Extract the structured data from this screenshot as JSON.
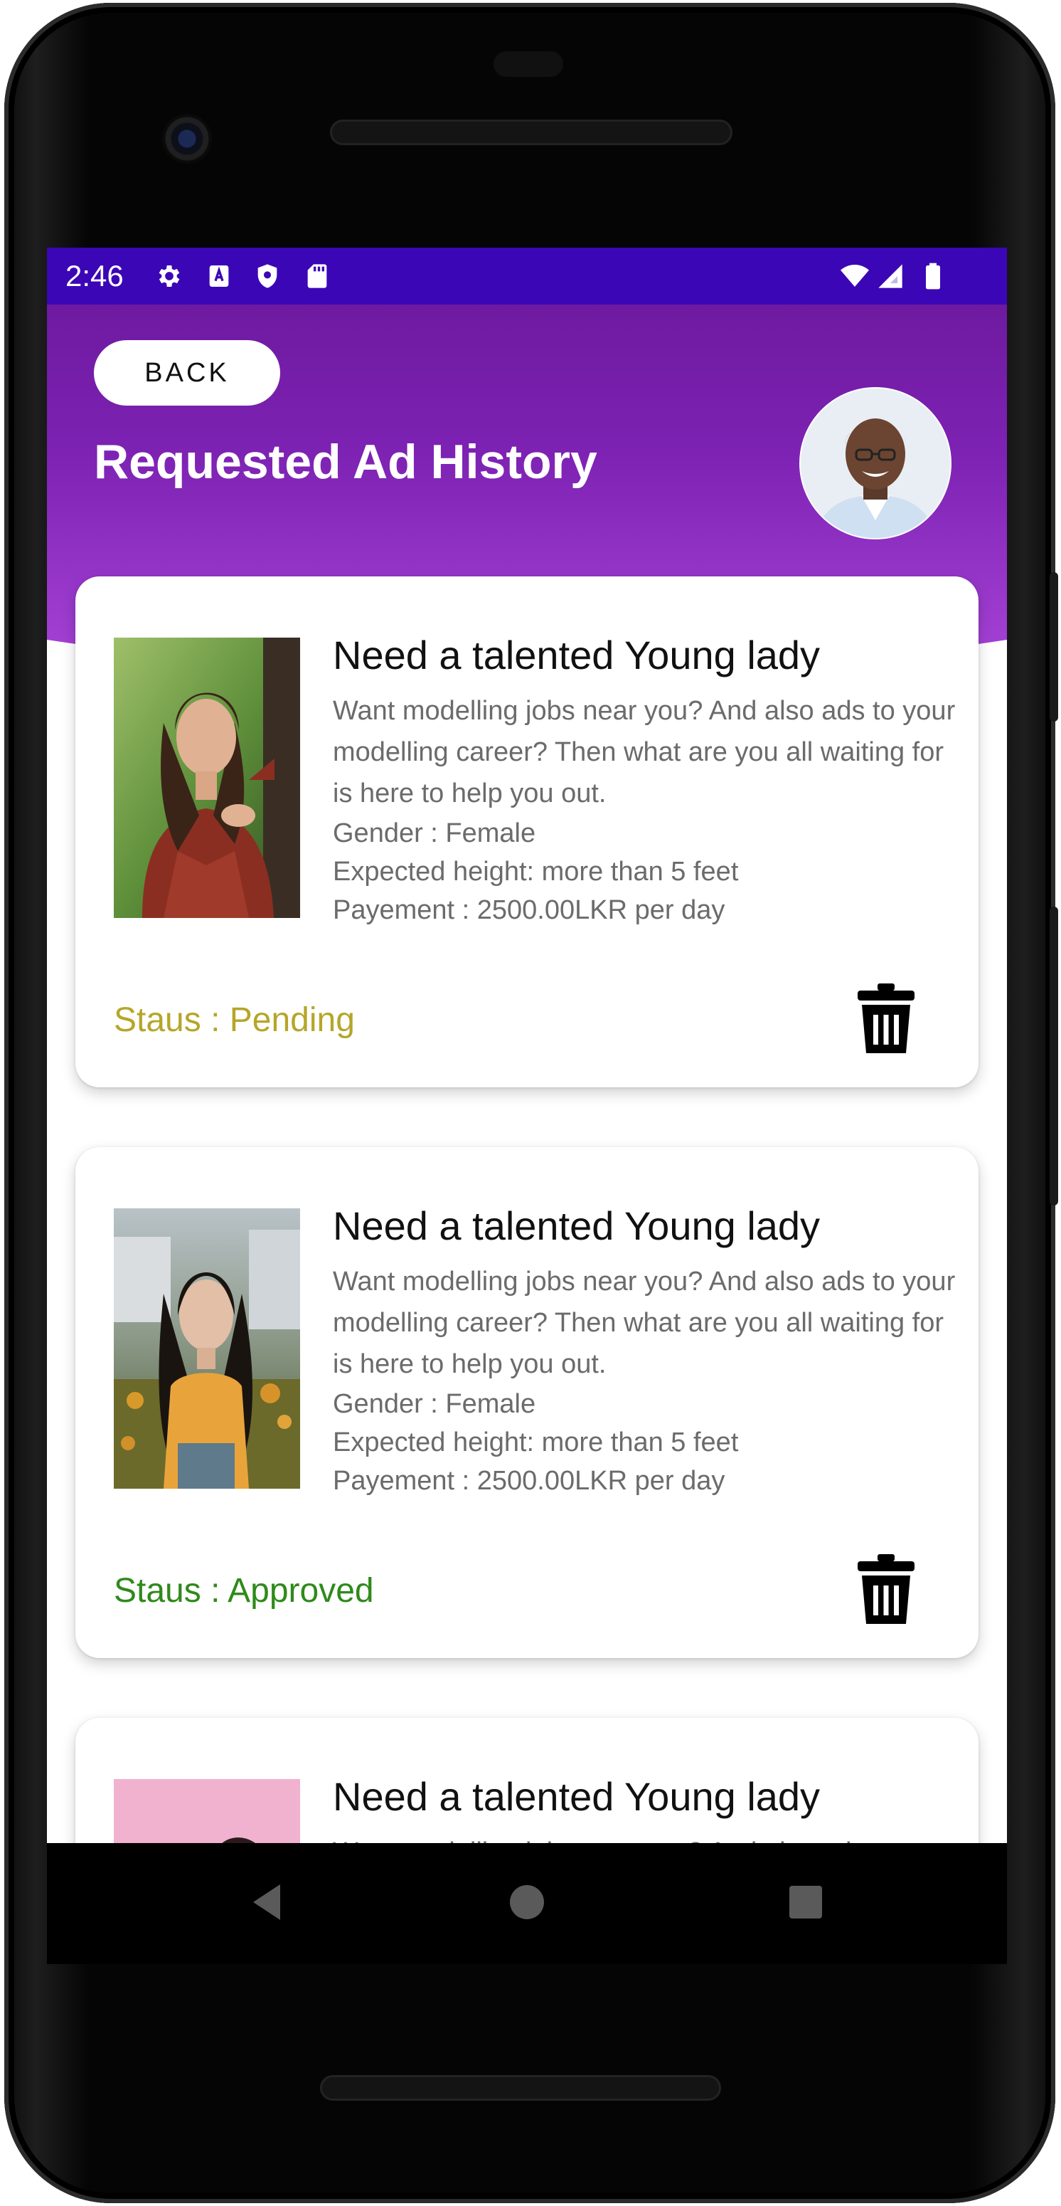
{
  "status_bar": {
    "time": "2:46",
    "icons": [
      "settings-icon",
      "a-box-icon",
      "shield-icon",
      "sd-card-icon",
      "wifi-icon",
      "signal-icon",
      "battery-icon"
    ]
  },
  "header": {
    "back_label": "BACK",
    "title": "Requested Ad History"
  },
  "cards": [
    {
      "title": "Need a talented Young lady",
      "description": "Want modelling jobs near you? And also ads to your modelling career? Then what are you all waiting for is here to help you out.",
      "gender": "Gender : Female",
      "height": "Expected height: more than 5 feet",
      "payment": "Payement : 2500.00LKR per day",
      "status": "Staus : Pending"
    },
    {
      "title": "Need a talented Young lady",
      "description": "Want modelling jobs near you? And also ads to your modelling career? Then what are you all waiting for is here to help you out.",
      "gender": "Gender : Female",
      "height": "Expected height: more than 5 feet",
      "payment": "Payement : 2500.00LKR per day",
      "status": "Staus : Approved"
    },
    {
      "title": "Need a talented Young lady",
      "description": "Want modelling jobs near you? And also ads to"
    }
  ],
  "colors": {
    "status_bar": "#3b06b6",
    "header_top": "#6e1aa0",
    "header_bottom": "#a844d8",
    "pending": "#b5a62a",
    "approved": "#2f8a1a"
  }
}
